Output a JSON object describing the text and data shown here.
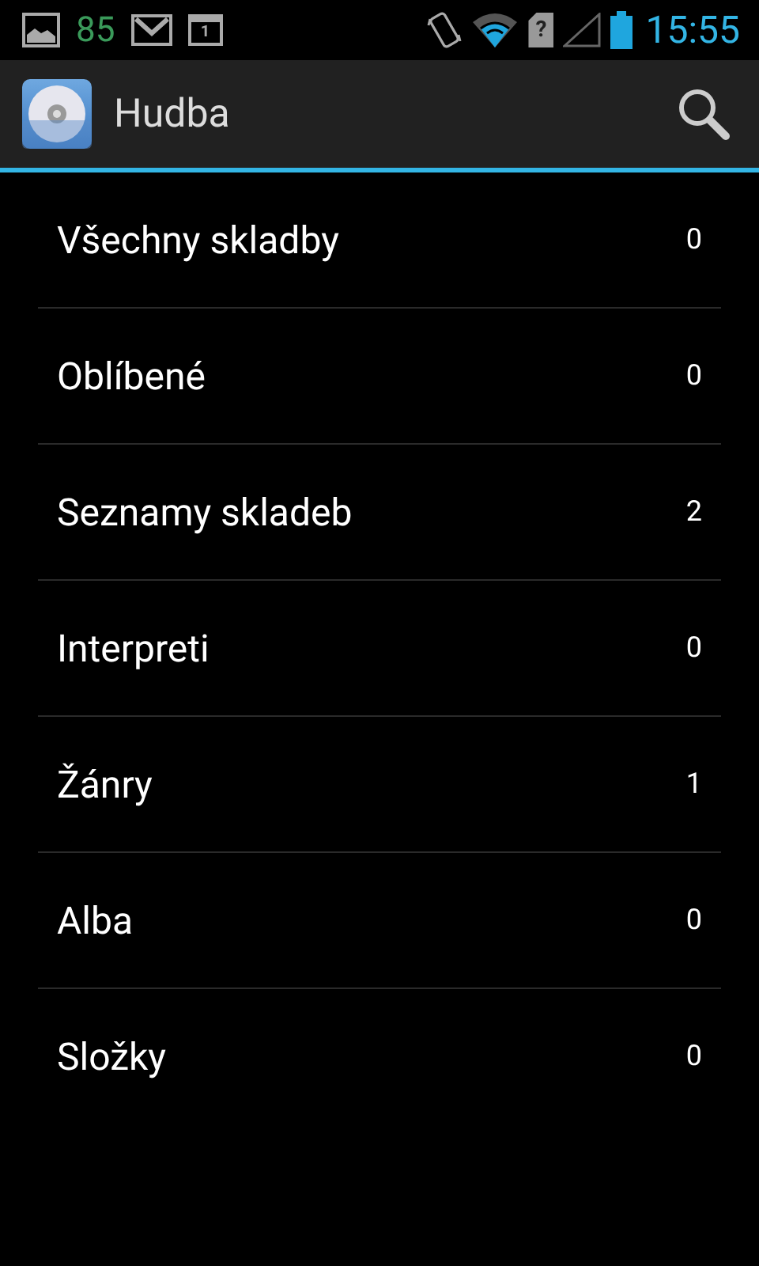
{
  "status_bar": {
    "battery_percent": "85",
    "calendar_day": "1",
    "sim_mark": "?",
    "time": "15:55"
  },
  "action_bar": {
    "title": "Hudba"
  },
  "categories": [
    {
      "label": "Všechny skladby",
      "count": "0"
    },
    {
      "label": "Oblíbené",
      "count": "0"
    },
    {
      "label": "Seznamy skladeb",
      "count": "2"
    },
    {
      "label": "Interpreti",
      "count": "0"
    },
    {
      "label": "Žánry",
      "count": "1"
    },
    {
      "label": "Alba",
      "count": "0"
    },
    {
      "label": "Složky",
      "count": "0"
    }
  ]
}
